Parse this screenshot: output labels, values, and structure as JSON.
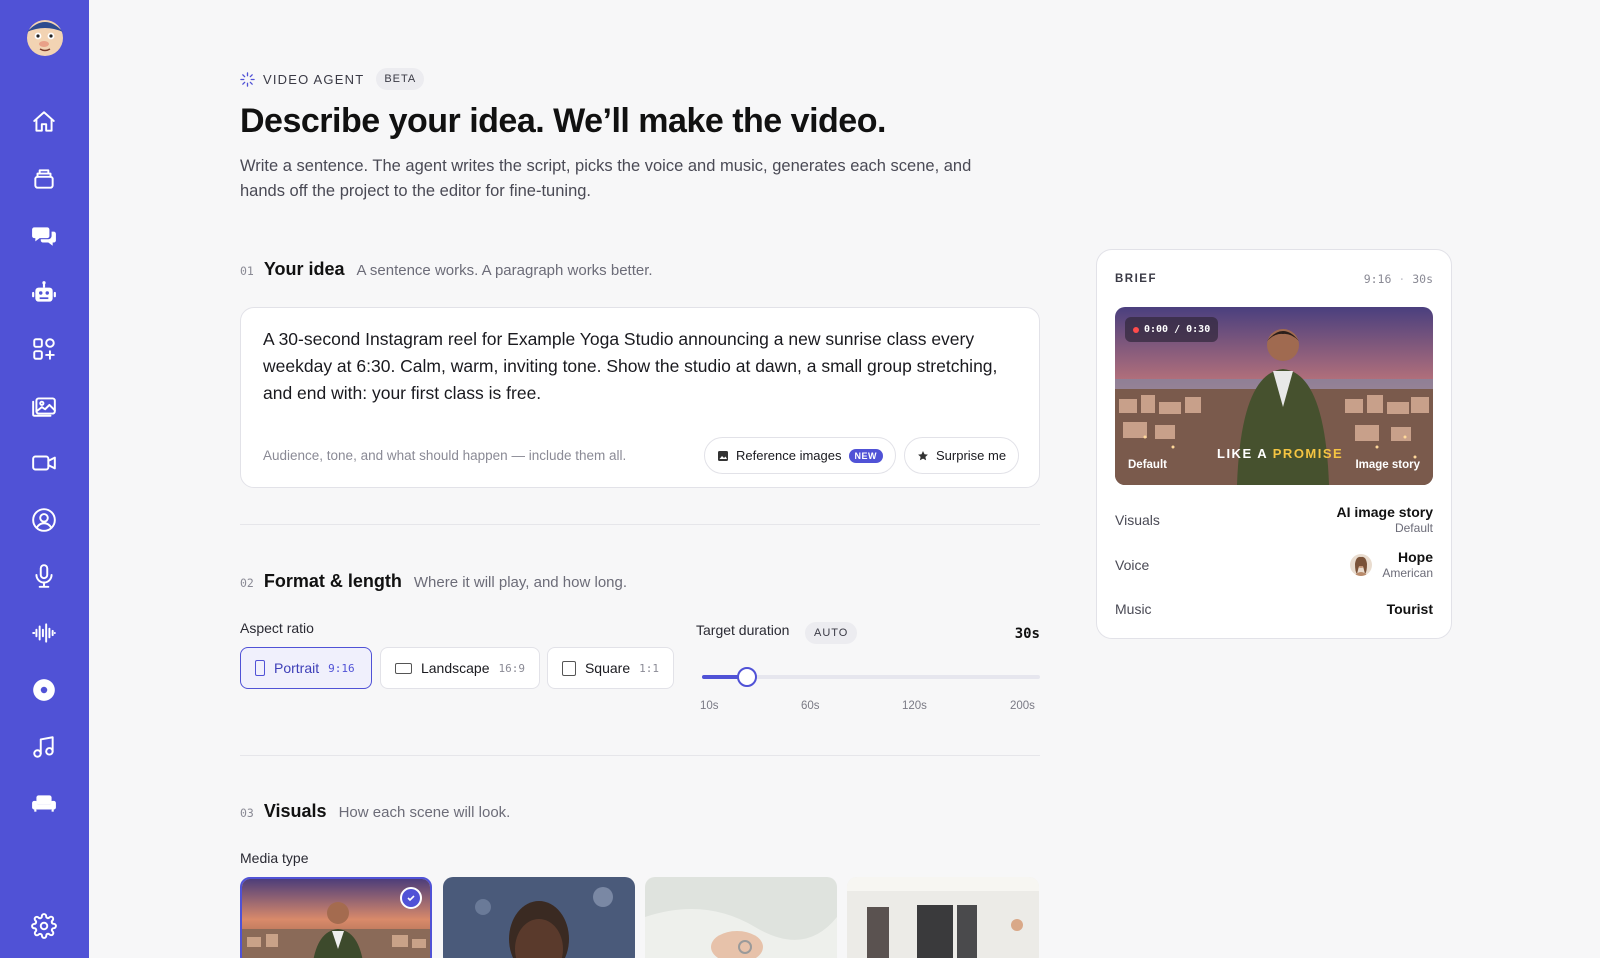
{
  "sidebar": {
    "items": [
      {
        "icon": "home-icon"
      },
      {
        "icon": "layers-icon"
      },
      {
        "icon": "chat-icon"
      },
      {
        "icon": "robot-icon"
      },
      {
        "icon": "apps-icon"
      },
      {
        "icon": "gallery-icon"
      },
      {
        "icon": "video-camera-icon"
      },
      {
        "icon": "user-circle-icon"
      },
      {
        "icon": "microphone-icon"
      },
      {
        "icon": "waveform-icon"
      },
      {
        "icon": "record-icon"
      },
      {
        "icon": "music-note-icon"
      },
      {
        "icon": "sofa-icon"
      }
    ],
    "settings_icon": "gear-icon"
  },
  "header": {
    "eyebrow": "VIDEO AGENT",
    "badge": "BETA",
    "title": "Describe your idea. We’ll make the video.",
    "subtitle": "Write a sentence. The agent writes the script, picks the voice and music, generates each scene, and hands off the project to the editor for fine-tuning."
  },
  "idea": {
    "num": "01",
    "title": "Your idea",
    "hint": "A sentence works. A paragraph works better.",
    "text": "A 30-second Instagram reel for Example Yoga Studio announcing a new sunrise class every weekday at 6:30. Calm, warm, inviting tone. Show the studio at dawn, a small group stretching, and end with: your first class is free.",
    "help": "Audience, tone, and what should happen — include them all.",
    "reference_label": "Reference images",
    "new_badge": "NEW",
    "surprise_label": "Surprise me"
  },
  "format": {
    "num": "02",
    "title": "Format & length",
    "hint": "Where it will play, and how long.",
    "aspect_label": "Aspect ratio",
    "ratios": [
      {
        "label": "Portrait",
        "ratio": "9:16",
        "selected": true
      },
      {
        "label": "Landscape",
        "ratio": "16:9",
        "selected": false
      },
      {
        "label": "Square",
        "ratio": "1:1",
        "selected": false
      }
    ],
    "duration_label": "Target duration",
    "auto_badge": "AUTO",
    "duration_value": "30s",
    "duration_seconds": 30,
    "ticks": [
      "10s",
      "60s",
      "120s",
      "200s"
    ]
  },
  "visuals": {
    "num": "03",
    "title": "Visuals",
    "hint": "How each scene will look.",
    "media_label": "Media type",
    "selected_index": 0
  },
  "brief": {
    "label": "BRIEF",
    "meta_ratio": "9:16",
    "meta_sep": "·",
    "meta_duration": "30s",
    "timecode": "0:00 / 0:30",
    "preview_left": "Default",
    "preview_right": "Image story",
    "caption_a": "LIKE A ",
    "caption_b": "PROMISE",
    "visuals_key": "Visuals",
    "visuals_value": "AI image story",
    "visuals_sub": "Default",
    "voice_key": "Voice",
    "voice_value": "Hope",
    "voice_sub": "American",
    "music_key": "Music",
    "music_value": "Tourist"
  },
  "colors": {
    "accent": "#5052d6",
    "caption_highlight": "#f5c542"
  }
}
